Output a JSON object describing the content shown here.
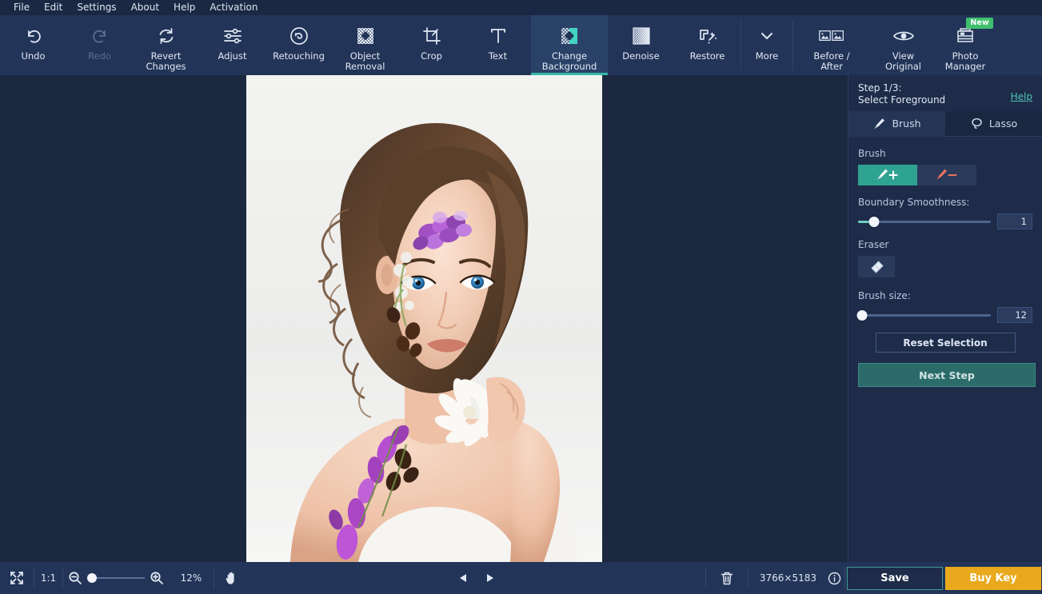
{
  "menu": {
    "items": [
      {
        "label": "File"
      },
      {
        "label": "Edit"
      },
      {
        "label": "Settings"
      },
      {
        "label": "About"
      },
      {
        "label": "Help"
      },
      {
        "label": "Activation"
      }
    ]
  },
  "toolbar": {
    "tools": [
      {
        "label": "Undo",
        "icon": "undo-icon",
        "state": "enabled"
      },
      {
        "label": "Redo",
        "icon": "redo-icon",
        "state": "disabled"
      },
      {
        "label": "Revert\nChanges",
        "label_line1": "Revert",
        "label_line2": "Changes",
        "icon": "revert-icon",
        "state": "enabled"
      },
      {
        "label": "Adjust",
        "icon": "sliders-icon",
        "state": "enabled"
      },
      {
        "label": "Retouching",
        "icon": "retouch-icon",
        "state": "enabled"
      },
      {
        "label": "Object\nRemoval",
        "label_line1": "Object",
        "label_line2": "Removal",
        "icon": "object-removal-icon",
        "state": "enabled"
      },
      {
        "label": "Crop",
        "icon": "crop-icon",
        "state": "enabled"
      },
      {
        "label": "Text",
        "icon": "text-icon",
        "state": "enabled"
      },
      {
        "label": "Change\nBackground",
        "label_line1": "Change",
        "label_line2": "Background",
        "icon": "change-background-icon",
        "state": "active"
      },
      {
        "label": "Denoise",
        "icon": "denoise-icon",
        "state": "enabled"
      },
      {
        "label": "Restore",
        "icon": "restore-icon",
        "state": "enabled"
      },
      {
        "label": "More",
        "icon": "chevron-down-icon",
        "state": "enabled"
      },
      {
        "label": "Before /\nAfter",
        "label_line1": "Before /",
        "label_line2": "After",
        "icon": "before-after-icon",
        "state": "enabled"
      },
      {
        "label": "View\nOriginal",
        "label_line1": "View",
        "label_line2": "Original",
        "icon": "eye-icon",
        "state": "enabled"
      },
      {
        "label": "Photo\nManager",
        "label_line1": "Photo",
        "label_line2": "Manager",
        "icon": "photo-manager-icon",
        "state": "enabled",
        "badge": "New"
      }
    ],
    "accent_active": "#35b8a8",
    "background": "#223457"
  },
  "panel": {
    "step_line1": "Step 1/3:",
    "step_line2": "Select Foreground",
    "help_label": "Help",
    "tabs": [
      {
        "label": "Brush",
        "icon": "brush-icon",
        "active": true
      },
      {
        "label": "Lasso",
        "icon": "lasso-icon",
        "active": false
      }
    ],
    "brush_label": "Brush",
    "brush_add_icon": "brush-plus-icon",
    "brush_subtract_icon": "brush-minus-icon",
    "boundary_label": "Boundary Smoothness:",
    "boundary_value": "1",
    "boundary_percent": 12,
    "eraser_label": "Eraser",
    "eraser_icon": "eraser-icon",
    "brush_size_label": "Brush size:",
    "brush_size_value": "12",
    "brush_size_percent": 3,
    "reset_label": "Reset Selection",
    "next_label": "Next Step",
    "accent_teal": "#2fa391",
    "accent_help": "#4fc3ad"
  },
  "statusbar": {
    "fit_icon": "fit-screen-icon",
    "actual_size_label": "1:1",
    "zoom_out_icon": "zoom-out-icon",
    "zoom_in_icon": "zoom-in-icon",
    "zoom_level": "12%",
    "zoom_percent": 8,
    "pan_icon": "hand-icon",
    "prev_icon": "prev-arrow-icon",
    "next_icon": "next-arrow-icon",
    "delete_icon": "trash-icon",
    "dimensions": "3766×5183",
    "info_icon": "info-icon",
    "save_label": "Save",
    "buy_label": "Buy Key",
    "buy_color": "#eaa91d"
  },
  "canvas": {
    "background": "#1c2840",
    "photo_alt": "portrait-of-woman-with-purple-flowers"
  }
}
